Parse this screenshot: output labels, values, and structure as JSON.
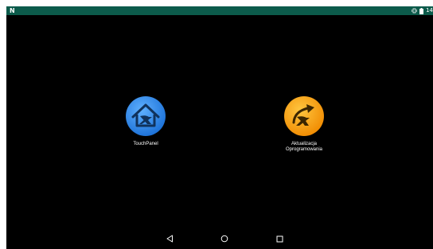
{
  "status_bar": {
    "logo": "N",
    "time": "14",
    "icons": [
      "vibrate-icon",
      "battery-icon"
    ],
    "color": "#0c5b4b"
  },
  "apps": [
    {
      "id": "touchpanel",
      "label_lines": [
        "TouchPanel"
      ],
      "icon": "house-x-icon",
      "color": "#2f8cf0"
    },
    {
      "id": "update",
      "label_lines": [
        "Aktualizacja",
        "Oprogramowania"
      ],
      "icon": "arrow-x-icon",
      "color": "#f7a800"
    }
  ],
  "nav_bar": {
    "buttons": [
      "back-icon",
      "home-icon",
      "recent-apps-icon"
    ]
  }
}
